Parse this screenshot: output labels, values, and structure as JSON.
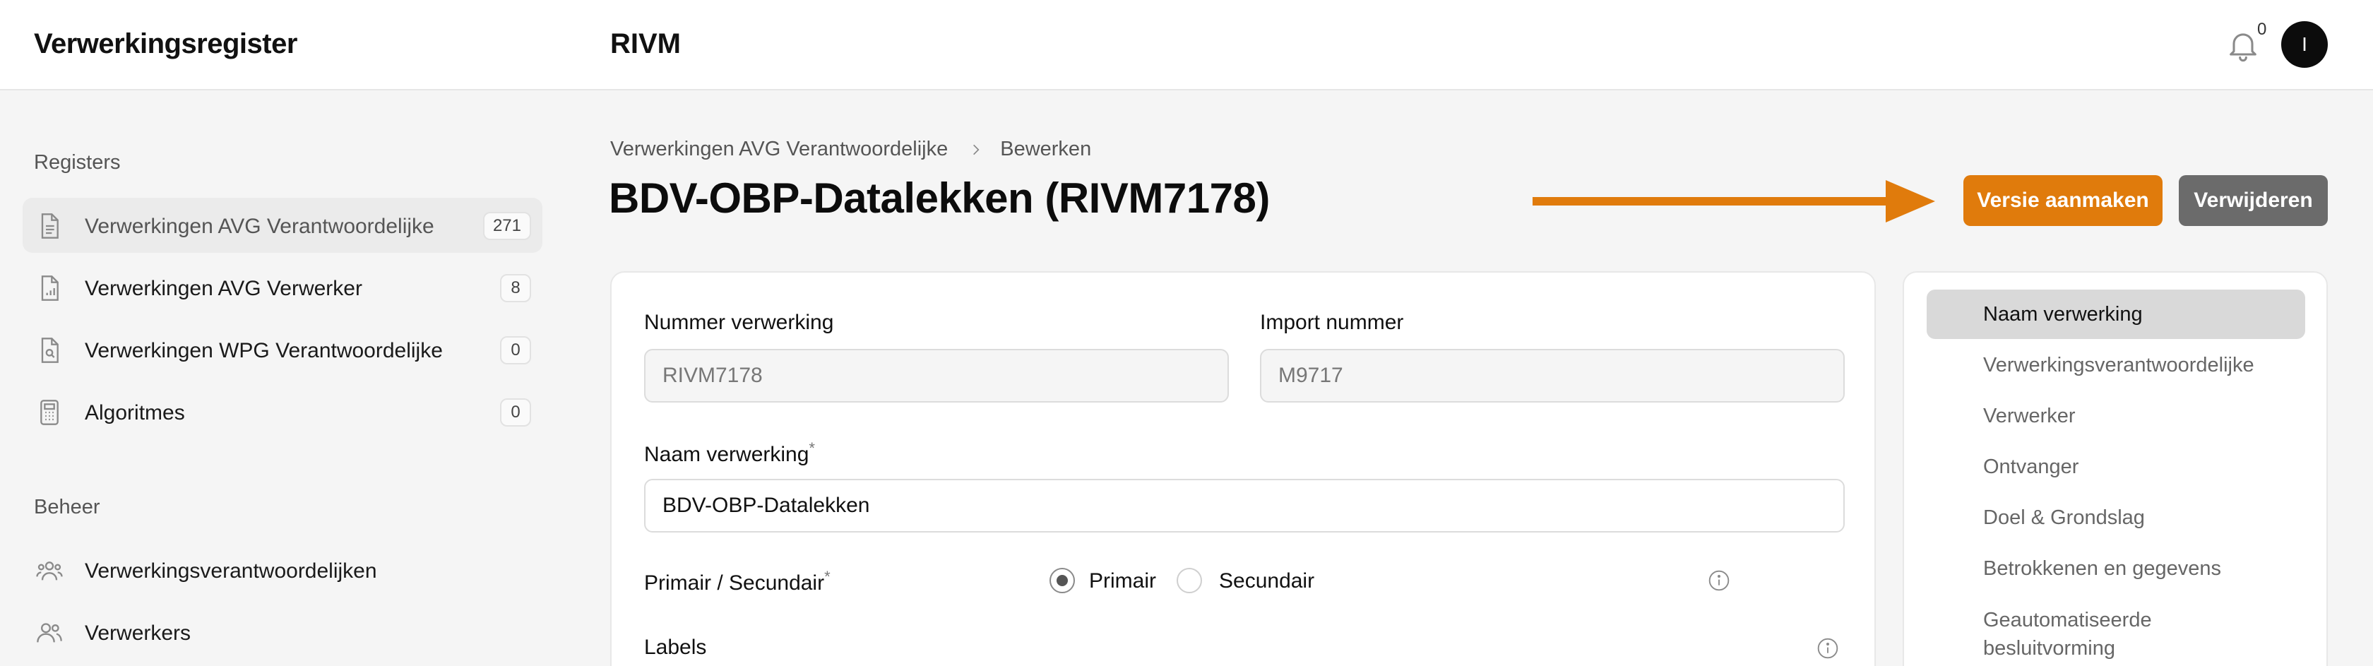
{
  "header": {
    "app_title": "Verwerkingsregister",
    "org_title": "RIVM",
    "notification_count": "0",
    "avatar_initial": "I"
  },
  "sidebar": {
    "registers_label": "Registers",
    "registers": [
      {
        "label": "Verwerkingen AVG Verantwoordelijke",
        "count": "271",
        "icon": "document-icon",
        "active": true
      },
      {
        "label": "Verwerkingen AVG Verwerker",
        "count": "8",
        "icon": "document-chart-icon",
        "active": false
      },
      {
        "label": "Verwerkingen WPG Verantwoordelijke",
        "count": "0",
        "icon": "document-search-icon",
        "active": false
      },
      {
        "label": "Algoritmes",
        "count": "0",
        "icon": "calculator-icon",
        "active": false
      }
    ],
    "beheer_label": "Beheer",
    "beheer": [
      {
        "label": "Verwerkingsverantwoordelijken",
        "icon": "users-group-icon"
      },
      {
        "label": "Verwerkers",
        "icon": "users-icon"
      }
    ]
  },
  "breadcrumb": {
    "parent": "Verwerkingen AVG Verantwoordelijke",
    "current": "Bewerken"
  },
  "page_title": "BDV-OBP-Datalekken (RIVM7178)",
  "actions": {
    "version_label": "Versie aanmaken",
    "delete_label": "Verwijderen"
  },
  "colors": {
    "accent": "#e07b0c",
    "delete": "#6b6b6b"
  },
  "form": {
    "nummer_label": "Nummer verwerking",
    "nummer_value": "RIVM7178",
    "import_label": "Import nummer",
    "import_value": "M9717",
    "naam_label": "Naam verwerking",
    "required_mark": "*",
    "naam_value": "BDV-OBP-Datalekken",
    "primair_label": "Primair / Secundair",
    "option_primair": "Primair",
    "option_secundair": "Secundair",
    "selected_option": "Primair",
    "labels_label": "Labels"
  },
  "section_nav": [
    {
      "label": "Naam verwerking",
      "active": true
    },
    {
      "label": "Verwerkingsverantwoordelijke",
      "active": false
    },
    {
      "label": "Verwerker",
      "active": false
    },
    {
      "label": "Ontvanger",
      "active": false
    },
    {
      "label": "Doel & Grondslag",
      "active": false
    },
    {
      "label": "Betrokkenen en gegevens",
      "active": false
    },
    {
      "label": "Geautomatiseerde besluitvorming",
      "active": false
    }
  ]
}
